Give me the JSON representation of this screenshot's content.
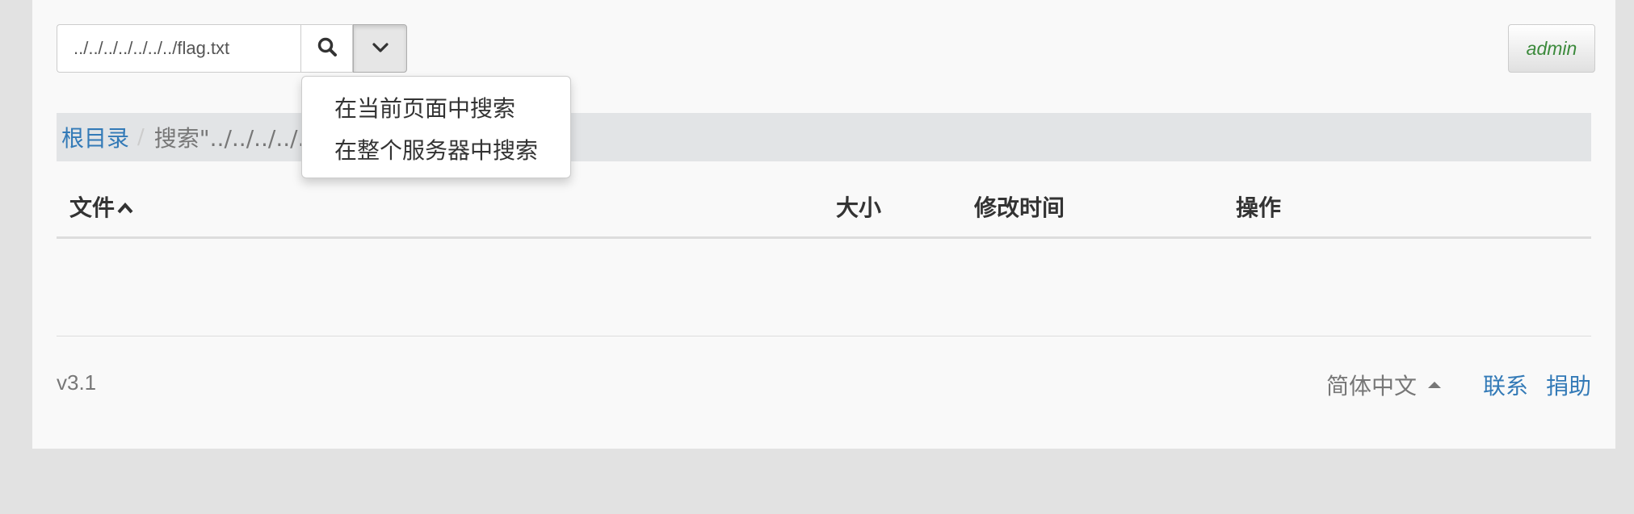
{
  "search": {
    "value": "../../../../../../../flag.txt",
    "search_icon": "magnifier-icon",
    "toggle_icon": "chevron-down-icon"
  },
  "dropdown": {
    "items": [
      "在当前页面中搜索",
      "在整个服务器中搜索"
    ]
  },
  "user": {
    "label": "admin"
  },
  "breadcrumb": {
    "root": "根目录",
    "separator": "/",
    "current": "搜索\"../../../../../../../flag.txt\""
  },
  "table": {
    "headers": {
      "file": "文件",
      "size": "大小",
      "mtime": "修改时间",
      "ops": "操作"
    },
    "sort_icon": "caret-up-icon"
  },
  "footer": {
    "version": "v3.1",
    "language": "简体中文",
    "links": [
      "联系",
      "捐助"
    ]
  },
  "colors": {
    "link": "#337ab7",
    "admin": "#3c8a3c",
    "breadcrumb_bg": "#e2e4e6"
  }
}
